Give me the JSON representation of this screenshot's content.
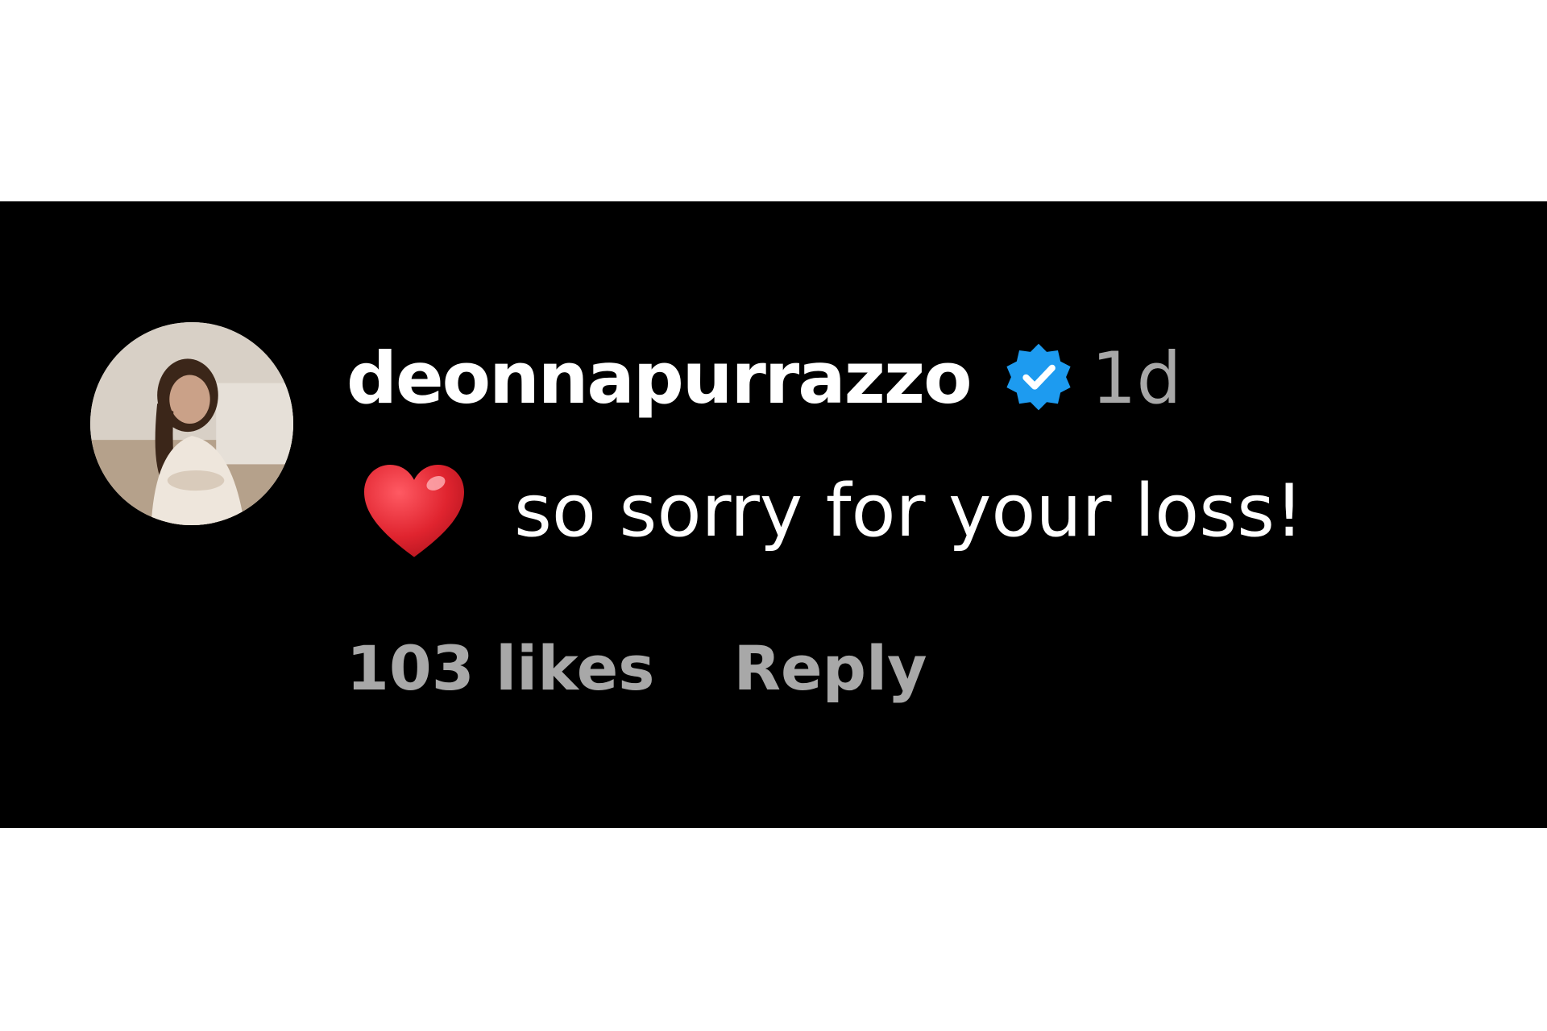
{
  "comment": {
    "username": "deonnapurrazzo",
    "verified": true,
    "verified_icon": "verified-badge-icon",
    "verified_color": "#1d9bf0",
    "time": "1d",
    "emoji_icon": "red-heart-icon",
    "text": "so sorry for your loss!",
    "likes": "103 likes",
    "reply_label": "Reply"
  },
  "colors": {
    "panel_background": "#000000",
    "page_background": "#ffffff",
    "primary_text": "#ffffff",
    "secondary_text": "#a8a8a8",
    "heart": "#e0242f"
  }
}
